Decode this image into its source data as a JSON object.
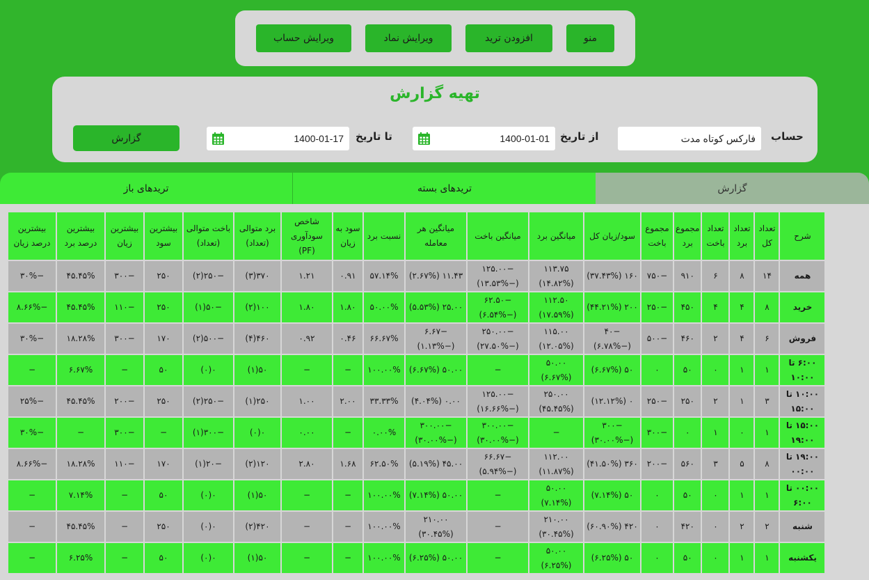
{
  "nav": {
    "menu": "منو",
    "add_trade": "افزودن ترید",
    "edit_symbol": "ویرایش نماد",
    "edit_account": "ویرایش حساب"
  },
  "report_form": {
    "title": "تهیه گزارش",
    "account_label": "حساب",
    "account_value": "فارکس کوتاه مدت",
    "from_label": "از تاریخ",
    "from_value": "1400-01-01",
    "to_label": "تا تاریخ",
    "to_value": "1400-01-17",
    "report_button": "گزارش"
  },
  "tabs": [
    "گزارش",
    "تریدهای بسته",
    "تریدهای باز"
  ],
  "table": {
    "headers": [
      "شرح",
      "تعداد کل",
      "تعداد برد",
      "تعداد باخت",
      "مجموع برد",
      "مجموع باخت",
      "سود/زیان کل",
      "میانگین برد",
      "میانگین باخت",
      "میانگین هر معامله",
      "نسبت برد",
      "سود به زیان",
      "شاخص سودآوری (PF)",
      "برد متوالی (تعداد)",
      "باخت متوالی (تعداد)",
      "بیشترین سود",
      "بیشترین زیان",
      "بیشترین درصد برد",
      "بیشترین درصد زیان"
    ],
    "rows": [
      [
        "همه",
        "۱۴",
        "۸",
        "۶",
        "۹۱۰",
        "−۷۵۰",
        "۱۶۰ (۳۷.۴۳%)",
        "۱۱۳.۷۵ (۱۴.۸۲%)",
        "−۱۲۵.۰۰ (−۱۳.۵۳%)",
        "۱۱.۴۳ (۲.۶۷%)",
        "۵۷.۱۴%",
        "۰.۹۱",
        "۱.۲۱",
        "۳۷۰(۳)",
        "−۲۵۰(۲)",
        "۲۵۰",
        "−۳۰۰",
        "۴۵.۴۵%",
        "−۳۰%"
      ],
      [
        "خرید",
        "۸",
        "۴",
        "۴",
        "۴۵۰",
        "−۲۵۰",
        "۲۰۰ (۴۴.۲۱%)",
        "۱۱۲.۵۰ (۱۷.۵۹%)",
        "−۶۲.۵۰ (−۶.۵۴%)",
        "۲۵.۰۰ (۵.۵۳%)",
        "۵۰.۰۰%",
        "۱.۸۰",
        "۱.۸۰",
        "۱۰۰(۲)",
        "−۵۰(۱)",
        "۲۵۰",
        "−۱۱۰",
        "۴۵.۴۵%",
        "−۸.۶۶%"
      ],
      [
        "فروش",
        "۶",
        "۴",
        "۲",
        "۴۶۰",
        "−۵۰۰",
        "−۴۰ (−۶.۷۸%)",
        "۱۱۵.۰۰ (۱۲.۰۵%)",
        "−۲۵۰.۰۰ (−۲۷.۵۰%)",
        "−۶.۶۷ (−۱.۱۳%)",
        "۶۶.۶۷%",
        "۰.۴۶",
        "۰.۹۲",
        "۴۶۰(۴)",
        "−۵۰۰(۲)",
        "۱۷۰",
        "−۳۰۰",
        "۱۸.۲۸%",
        "−۳۰%"
      ],
      [
        "۶:۰۰ تا ۱۰:۰۰",
        "۱",
        "۱",
        "۰",
        "۵۰",
        "۰",
        "۵۰ (۶.۶۷%)",
        "۵۰.۰۰ (۶.۶۷%)",
        "−",
        "۵۰.۰۰ (۶.۶۷%)",
        "۱۰۰.۰۰%",
        "−",
        "−",
        "۵۰(۱)",
        "۰(۰)",
        "۵۰",
        "−",
        "۶.۶۷%",
        "−"
      ],
      [
        "۱۰:۰۰ تا ۱۵:۰۰",
        "۳",
        "۱",
        "۲",
        "۲۵۰",
        "−۲۵۰",
        "۰ (۱۲.۱۲%)",
        "۲۵۰.۰۰ (۴۵.۴۵%)",
        "−۱۲۵.۰۰ (−۱۶.۶۶%)",
        "۰.۰۰ (۴.۰۴%)",
        "۳۳.۳۳%",
        "۲.۰۰",
        "۱.۰۰",
        "۲۵۰(۱)",
        "−۲۵۰(۲)",
        "۲۵۰",
        "−۲۰۰",
        "۴۵.۴۵%",
        "−۲۵%"
      ],
      [
        "۱۵:۰۰ تا ۱۹:۰۰",
        "۱",
        "۰",
        "۱",
        "۰",
        "−۳۰۰",
        "−۳۰۰ (−۳۰.۰۰%)",
        "−",
        "−۳۰۰.۰۰ (−۳۰.۰۰%)",
        "−۳۰۰.۰۰ (−۳۰.۰۰%)",
        "۰.۰۰%",
        "−",
        "۰.۰۰",
        "۰(۰)",
        "−۳۰۰(۱)",
        "−",
        "−۳۰۰",
        "−",
        "−۳۰%"
      ],
      [
        "۱۹:۰۰ تا ۰۰:۰۰",
        "۸",
        "۵",
        "۳",
        "۵۶۰",
        "−۲۰۰",
        "۳۶۰ (۴۱.۵۰%)",
        "۱۱۲.۰۰ (۱۱.۸۷%)",
        "−۶۶.۶۷ (−۵.۹۴%)",
        "۴۵.۰۰ (۵.۱۹%)",
        "۶۲.۵۰%",
        "۱.۶۸",
        "۲.۸۰",
        "۱۲۰(۲)",
        "−۲۰(۱)",
        "۱۷۰",
        "−۱۱۰",
        "۱۸.۲۸%",
        "−۸.۶۶%"
      ],
      [
        "۰۰:۰۰ تا ۶:۰۰",
        "۱",
        "۱",
        "۰",
        "۵۰",
        "۰",
        "۵۰ (۷.۱۴%)",
        "۵۰.۰۰ (۷.۱۴%)",
        "−",
        "۵۰.۰۰ (۷.۱۴%)",
        "۱۰۰.۰۰%",
        "−",
        "−",
        "۵۰(۱)",
        "۰(۰)",
        "۵۰",
        "−",
        "۷.۱۴%",
        "−"
      ],
      [
        "شنبه",
        "۲",
        "۲",
        "۰",
        "۴۲۰",
        "۰",
        "۴۲۰ (۶۰.۹۰%)",
        "۲۱۰.۰۰ (۳۰.۴۵%)",
        "−",
        "۲۱۰.۰۰ (۳۰.۴۵%)",
        "۱۰۰.۰۰%",
        "−",
        "−",
        "۴۲۰(۲)",
        "۰(۰)",
        "۲۵۰",
        "−",
        "۴۵.۴۵%",
        "−"
      ],
      [
        "یکشنبه",
        "۱",
        "۱",
        "۰",
        "۵۰",
        "۰",
        "۵۰ (۶.۲۵%)",
        "۵۰.۰۰ (۶.۲۵%)",
        "−",
        "۵۰.۰۰ (۶.۲۵%)",
        "۱۰۰.۰۰%",
        "−",
        "−",
        "۵۰(۱)",
        "۰(۰)",
        "۵۰",
        "−",
        "۶.۲۵%",
        "−"
      ]
    ]
  },
  "colors": {
    "background": "#31b52c",
    "panel": "#d7d7d7",
    "button": "#2ab52a",
    "row_green": "#3eea36",
    "row_gray": "#b4b4b4",
    "active_tab": "#9bb69a"
  },
  "icons": {
    "date_picker": "calendar-icon"
  }
}
